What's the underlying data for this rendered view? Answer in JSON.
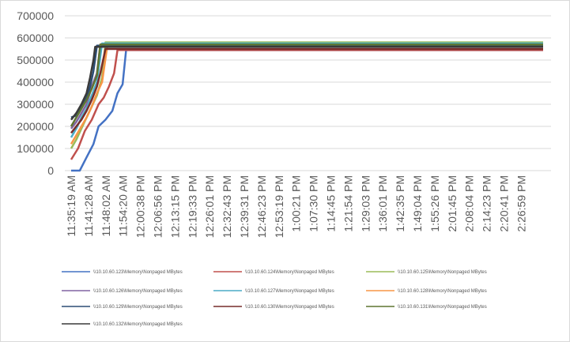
{
  "chart_data": {
    "type": "line",
    "title": "",
    "xlabel": "",
    "ylabel": "",
    "ylim": [
      0,
      700000
    ],
    "yticks": [
      "0",
      "100000",
      "200000",
      "300000",
      "400000",
      "500000",
      "600000",
      "700000"
    ],
    "x_tick_labels": [
      "11:35:19 AM",
      "11:41:28 AM",
      "11:48:02 AM",
      "11:54:20 AM",
      "12:00:38 PM",
      "12:06:56 PM",
      "12:13:15 PM",
      "12:19:33 PM",
      "12:26:01 PM",
      "12:32:43 PM",
      "12:39:31 PM",
      "12:46:23 PM",
      "12:53:19 PM",
      "1:00:21 PM",
      "1:07:30 PM",
      "1:14:45 PM",
      "1:21:54 PM",
      "1:29:03 PM",
      "1:36:01 PM",
      "1:42:35 PM",
      "1:49:04 PM",
      "1:55:26 PM",
      "2:01:45 PM",
      "2:08:04 PM",
      "2:14:23 PM",
      "2:20:41 PM",
      "2:26:59 PM"
    ],
    "grid": "horizontal",
    "legend_position": "bottom",
    "series": [
      {
        "name": "\\\\10.10.60.123\\Memory\\Nonpaged MBytes",
        "color": "#4472c4",
        "points": [
          [
            0,
            0
          ],
          [
            0.5,
            0
          ],
          [
            0.9,
            60000
          ],
          [
            1.3,
            120000
          ],
          [
            1.6,
            200000
          ],
          [
            2.0,
            230000
          ],
          [
            2.4,
            270000
          ],
          [
            2.7,
            350000
          ],
          [
            3.0,
            390000
          ],
          [
            3.2,
            545000
          ],
          [
            27.5,
            545000
          ]
        ]
      },
      {
        "name": "\\\\10.10.60.124\\Memory\\Nonpaged MBytes",
        "color": "#c0504d",
        "points": [
          [
            0,
            50000
          ],
          [
            0.4,
            100000
          ],
          [
            0.8,
            180000
          ],
          [
            1.2,
            230000
          ],
          [
            1.6,
            300000
          ],
          [
            1.9,
            330000
          ],
          [
            2.2,
            380000
          ],
          [
            2.5,
            440000
          ],
          [
            2.7,
            545000
          ],
          [
            27.5,
            545000
          ]
        ]
      },
      {
        "name": "\\\\10.10.60.125\\Memory\\Nonpaged MBytes",
        "color": "#9bbb59",
        "points": [
          [
            0,
            100000
          ],
          [
            0.3,
            140000
          ],
          [
            0.6,
            190000
          ],
          [
            0.9,
            240000
          ],
          [
            1.2,
            290000
          ],
          [
            1.5,
            340000
          ],
          [
            1.8,
            420000
          ],
          [
            2.0,
            580000
          ],
          [
            27.5,
            580000
          ]
        ]
      },
      {
        "name": "\\\\10.10.60.126\\Memory\\Nonpaged MBytes",
        "color": "#8064a2",
        "points": [
          [
            0,
            190000
          ],
          [
            0.3,
            220000
          ],
          [
            0.6,
            260000
          ],
          [
            0.9,
            300000
          ],
          [
            1.2,
            380000
          ],
          [
            1.5,
            440000
          ],
          [
            1.7,
            570000
          ],
          [
            27.5,
            570000
          ]
        ]
      },
      {
        "name": "\\\\10.10.60.127\\Memory\\Nonpaged MBytes",
        "color": "#4bacc6",
        "points": [
          [
            0,
            150000
          ],
          [
            0.3,
            190000
          ],
          [
            0.6,
            240000
          ],
          [
            0.9,
            280000
          ],
          [
            1.2,
            340000
          ],
          [
            1.5,
            400000
          ],
          [
            1.8,
            575000
          ],
          [
            27.5,
            575000
          ]
        ]
      },
      {
        "name": "\\\\10.10.60.128\\Memory\\Nonpaged MBytes",
        "color": "#f79646",
        "points": [
          [
            0,
            120000
          ],
          [
            0.3,
            160000
          ],
          [
            0.6,
            200000
          ],
          [
            0.9,
            240000
          ],
          [
            1.2,
            290000
          ],
          [
            1.5,
            350000
          ],
          [
            1.8,
            400000
          ],
          [
            2.1,
            560000
          ],
          [
            27.5,
            560000
          ]
        ]
      },
      {
        "name": "\\\\10.10.60.129\\Memory\\Nonpaged MBytes",
        "color": "#2c4d75",
        "points": [
          [
            0,
            240000
          ],
          [
            0.3,
            250000
          ],
          [
            0.6,
            290000
          ],
          [
            0.9,
            330000
          ],
          [
            1.1,
            380000
          ],
          [
            1.3,
            450000
          ],
          [
            1.5,
            565000
          ],
          [
            27.5,
            565000
          ]
        ]
      },
      {
        "name": "\\\\10.10.60.130\\Memory\\Nonpaged MBytes",
        "color": "#772c2a",
        "points": [
          [
            0,
            170000
          ],
          [
            0.3,
            200000
          ],
          [
            0.6,
            230000
          ],
          [
            0.9,
            270000
          ],
          [
            1.2,
            320000
          ],
          [
            1.5,
            380000
          ],
          [
            1.7,
            440000
          ],
          [
            2.0,
            550000
          ],
          [
            27.5,
            550000
          ]
        ]
      },
      {
        "name": "\\\\10.10.60.131\\Memory\\Nonpaged MBytes",
        "color": "#5f7530",
        "points": [
          [
            0,
            200000
          ],
          [
            0.3,
            240000
          ],
          [
            0.6,
            280000
          ],
          [
            0.9,
            320000
          ],
          [
            1.2,
            370000
          ],
          [
            1.5,
            430000
          ],
          [
            1.7,
            570000
          ],
          [
            27.5,
            570000
          ]
        ]
      },
      {
        "name": "\\\\10.10.60.132\\Memory\\Nonpaged MBytes",
        "color": "#3a3a3a",
        "points": [
          [
            0,
            230000
          ],
          [
            0.3,
            260000
          ],
          [
            0.6,
            300000
          ],
          [
            0.9,
            350000
          ],
          [
            1.1,
            420000
          ],
          [
            1.3,
            500000
          ],
          [
            1.4,
            560000
          ],
          [
            27.5,
            560000
          ]
        ]
      }
    ]
  }
}
